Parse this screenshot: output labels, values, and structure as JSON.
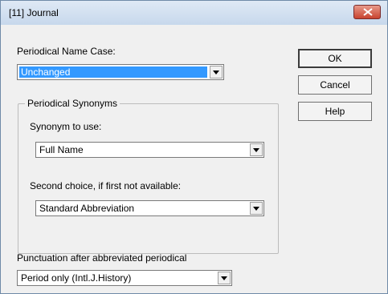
{
  "window": {
    "title": "[11] Journal"
  },
  "name_case": {
    "label": "Periodical Name Case:",
    "value": "Unchanged"
  },
  "synonyms": {
    "title": "Periodical Synonyms",
    "first": {
      "label": "Synonym to use:",
      "value": "Full Name"
    },
    "second": {
      "label": "Second choice, if first not available:",
      "value": "Standard Abbreviation"
    }
  },
  "punctuation": {
    "label": "Punctuation after abbreviated periodical",
    "value": "Period only (Intl.J.History)"
  },
  "buttons": {
    "ok": "OK",
    "cancel": "Cancel",
    "help": "Help"
  },
  "colors": {
    "selection": "#3399ff",
    "titlebar": "#c7d8ec",
    "close": "#c8432f"
  }
}
